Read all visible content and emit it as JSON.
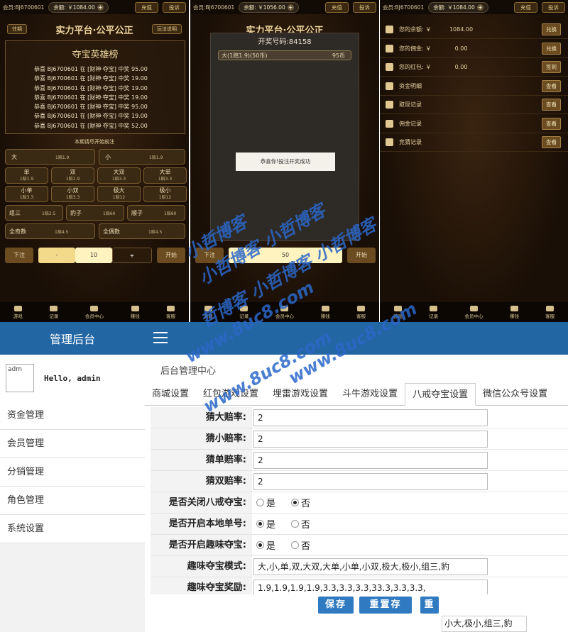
{
  "phone1": {
    "member": "会员:BJ6700601",
    "balance": "余额: ￥1084.00",
    "btn_recharge": "充值",
    "btn_withdraw": "投诉",
    "title": "实力平台·公平公正",
    "left_btn": "往期",
    "right_btn": "玩法说明",
    "board_title": "夺宝英雄榜",
    "board_rows": [
      "恭喜 BJ6700601 在 [财神·夺宝] 中奖 95.00",
      "恭喜 BJ6700601 在 [财神·夺宝] 中奖 19.00",
      "恭喜 BJ6700601 在 [财神·夺宝] 中奖 19.00",
      "恭喜 BJ6700601 在 [财神·夺宝] 中奖 19.00",
      "恭喜 BJ6700601 在 [财神·夺宝] 中奖 95.00",
      "恭喜 BJ6700601 在 [财神·夺宝] 中奖 19.00",
      "恭喜 BJ6700601 在 [财神·夺宝] 中奖 52.00"
    ],
    "note": "本期请尽开始前注",
    "big": "大",
    "big_odds": "1赔1.9",
    "small": "小",
    "small_odds": "1赔1.9",
    "grid": [
      {
        "name": "单",
        "odds": "1赔1.9"
      },
      {
        "name": "双",
        "odds": "1赔1.9"
      },
      {
        "name": "大双",
        "odds": "1赔3.3"
      },
      {
        "name": "大单",
        "odds": "1赔3.3"
      },
      {
        "name": "小单",
        "odds": "1赔3.3"
      },
      {
        "name": "小双",
        "odds": "1赔3.3"
      },
      {
        "name": "极大",
        "odds": "1赔12"
      },
      {
        "name": "极小",
        "odds": "1赔12"
      }
    ],
    "row3": [
      {
        "name": "组三",
        "odds": "1赔2.5"
      },
      {
        "name": "豹子",
        "odds": "1赔60"
      },
      {
        "name": "顺子",
        "odds": "1赔60"
      }
    ],
    "row4": [
      {
        "name": "全奇数",
        "odds": "1赔4.5"
      },
      {
        "name": "全偶数",
        "odds": "1赔4.5"
      }
    ],
    "bet_btn": "下注",
    "minus": "-",
    "amount": "10",
    "plus": "+",
    "start": "开始"
  },
  "phone2": {
    "member": "会员:BJ6700601",
    "balance": "余额: ￥1056.00",
    "btn_recharge": "充值",
    "btn_withdraw": "投诉",
    "title": "实力平台·公平公正",
    "modal_title": "开奖号码:84158",
    "modal_bet": "大(1赔1.9)(50币)",
    "modal_bet_coins": "95币",
    "toast": "恭喜你!投注开奖成功",
    "bet_btn": "下注",
    "amount": "50",
    "start": "开始"
  },
  "phone3": {
    "member": "会员:BJ6700601",
    "balance": "余额: ￥1084.00",
    "btn_recharge": "充值",
    "btn_withdraw": "投诉",
    "rows": [
      {
        "label": "您的余额:  ￥",
        "value": "1084.00",
        "btn": "兑换"
      },
      {
        "label": "您的佣金:  ￥",
        "value": "0.00",
        "btn": "兑换"
      },
      {
        "label": "您的红包:  ￥",
        "value": "0.00",
        "btn": "签到"
      },
      {
        "label": "资金明细",
        "value": "",
        "btn": "查看"
      },
      {
        "label": "取现记录",
        "value": "",
        "btn": "查看"
      },
      {
        "label": "佣金记录",
        "value": "",
        "btn": "查看"
      },
      {
        "label": "竞猜记录",
        "value": "",
        "btn": "查看"
      }
    ]
  },
  "tabbar": [
    "游戏",
    "记录",
    "会员中心",
    "赚钱",
    "客服"
  ],
  "admin": {
    "brand": "管理后台",
    "avatar_alt": "adm",
    "hello": "Hello, admin",
    "menu": [
      "资金管理",
      "会员管理",
      "分销管理",
      "角色管理",
      "系统设置"
    ],
    "breadcrumb": "后台管理中心",
    "tabs": [
      "商城设置",
      "红包游戏设置",
      "埋雷游戏设置",
      "斗牛游戏设置",
      "八戒夺宝设置",
      "微信公众号设置"
    ],
    "active_tab": 4,
    "fields": [
      {
        "label": "猜大赔率:",
        "value": "2"
      },
      {
        "label": "猜小赔率:",
        "value": "2"
      },
      {
        "label": "猜单赔率:",
        "value": "2"
      },
      {
        "label": "猜双赔率:",
        "value": "2"
      }
    ],
    "radios": [
      {
        "label": "是否关闭八戒夺宝:",
        "yes": "是",
        "no": "否",
        "selected": "no"
      },
      {
        "label": "是否开启本地单号:",
        "yes": "是",
        "no": "否",
        "selected": "yes"
      },
      {
        "label": "是否开启趣味夺宝:",
        "yes": "是",
        "no": "否",
        "selected": "yes"
      }
    ],
    "mode_label": "趣味夺宝模式:",
    "mode_value": "大,小,单,双,大双,大单,小单,小双,极大,极小,组三,豹",
    "reward_label": "趣味夺宝奖励:",
    "reward_value": "1.9,1.9,1.9,1.9,3.3,3.3,3.3,33.3,3.3,3.3,",
    "save": "保存",
    "reset": "重置存",
    "reset2": "重",
    "suggest": "小大,极小,组三,豹"
  },
  "watermark": {
    "line1": "小哲博客",
    "line2": "小哲博客 小哲博客",
    "line3": "哲博客 小哲博客 小哲博客",
    "line4": "www.8uc8.com",
    "line5": "www.8uc8.com",
    "line6": "www.8uc8.com"
  }
}
